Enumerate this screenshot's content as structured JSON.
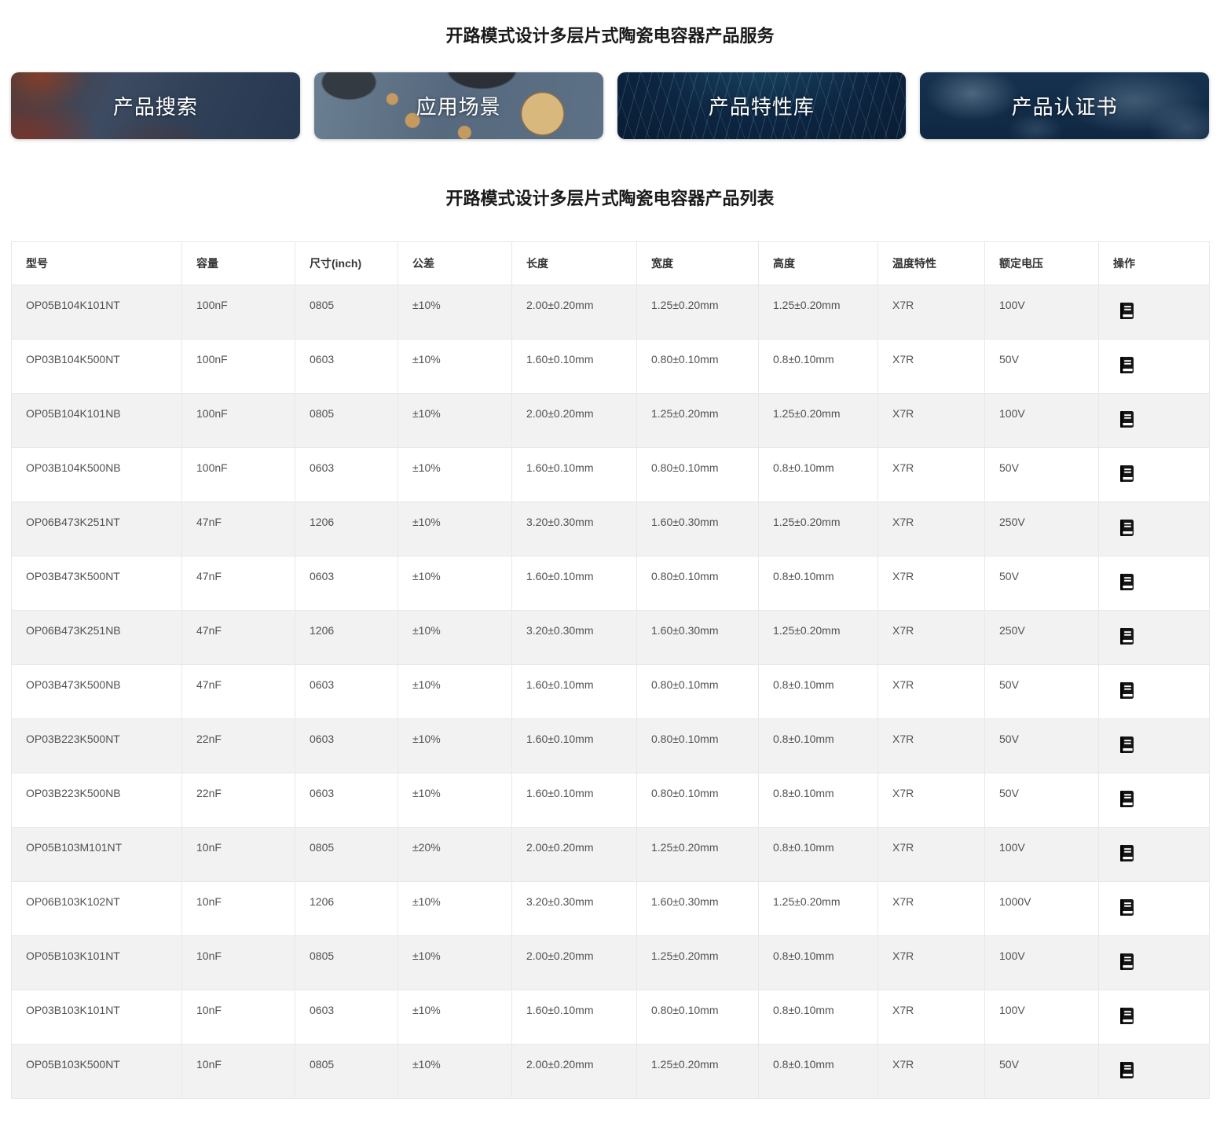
{
  "page": {
    "service_title": "开路模式设计多层片式陶瓷电容器产品服务",
    "list_title": "开路模式设计多层片式陶瓷电容器产品列表"
  },
  "nav_cards": [
    {
      "label": "产品搜索"
    },
    {
      "label": "应用场景"
    },
    {
      "label": "产品特性库"
    },
    {
      "label": "产品认证书"
    }
  ],
  "table": {
    "columns": [
      "型号",
      "容量",
      "尺寸(inch)",
      "公差",
      "长度",
      "宽度",
      "高度",
      "温度特性",
      "额定电压",
      "操作"
    ],
    "column_keys": [
      "model",
      "capacity",
      "size",
      "tolerance",
      "length",
      "width",
      "height",
      "temp-char",
      "rated-voltage",
      "action"
    ],
    "action_icon": "book-icon",
    "rows": [
      [
        "OP05B104K101NT",
        "100nF",
        "0805",
        "±10%",
        "2.00±0.20mm",
        "1.25±0.20mm",
        "1.25±0.20mm",
        "X7R",
        "100V"
      ],
      [
        "OP03B104K500NT",
        "100nF",
        "0603",
        "±10%",
        "1.60±0.10mm",
        "0.80±0.10mm",
        "0.8±0.10mm",
        "X7R",
        "50V"
      ],
      [
        "OP05B104K101NB",
        "100nF",
        "0805",
        "±10%",
        "2.00±0.20mm",
        "1.25±0.20mm",
        "1.25±0.20mm",
        "X7R",
        "100V"
      ],
      [
        "OP03B104K500NB",
        "100nF",
        "0603",
        "±10%",
        "1.60±0.10mm",
        "0.80±0.10mm",
        "0.8±0.10mm",
        "X7R",
        "50V"
      ],
      [
        "OP06B473K251NT",
        "47nF",
        "1206",
        "±10%",
        "3.20±0.30mm",
        "1.60±0.30mm",
        "1.25±0.20mm",
        "X7R",
        "250V"
      ],
      [
        "OP03B473K500NT",
        "47nF",
        "0603",
        "±10%",
        "1.60±0.10mm",
        "0.80±0.10mm",
        "0.8±0.10mm",
        "X7R",
        "50V"
      ],
      [
        "OP06B473K251NB",
        "47nF",
        "1206",
        "±10%",
        "3.20±0.30mm",
        "1.60±0.30mm",
        "1.25±0.20mm",
        "X7R",
        "250V"
      ],
      [
        "OP03B473K500NB",
        "47nF",
        "0603",
        "±10%",
        "1.60±0.10mm",
        "0.80±0.10mm",
        "0.8±0.10mm",
        "X7R",
        "50V"
      ],
      [
        "OP03B223K500NT",
        "22nF",
        "0603",
        "±10%",
        "1.60±0.10mm",
        "0.80±0.10mm",
        "0.8±0.10mm",
        "X7R",
        "50V"
      ],
      [
        "OP03B223K500NB",
        "22nF",
        "0603",
        "±10%",
        "1.60±0.10mm",
        "0.80±0.10mm",
        "0.8±0.10mm",
        "X7R",
        "50V"
      ],
      [
        "OP05B103M101NT",
        "10nF",
        "0805",
        "±20%",
        "2.00±0.20mm",
        "1.25±0.20mm",
        "0.8±0.10mm",
        "X7R",
        "100V"
      ],
      [
        "OP06B103K102NT",
        "10nF",
        "1206",
        "±10%",
        "3.20±0.30mm",
        "1.60±0.30mm",
        "1.25±0.20mm",
        "X7R",
        "1000V"
      ],
      [
        "OP05B103K101NT",
        "10nF",
        "0805",
        "±10%",
        "2.00±0.20mm",
        "1.25±0.20mm",
        "0.8±0.10mm",
        "X7R",
        "100V"
      ],
      [
        "OP03B103K101NT",
        "10nF",
        "0603",
        "±10%",
        "1.60±0.10mm",
        "0.80±0.10mm",
        "0.8±0.10mm",
        "X7R",
        "100V"
      ],
      [
        "OP05B103K500NT",
        "10nF",
        "0805",
        "±10%",
        "2.00±0.20mm",
        "1.25±0.20mm",
        "0.8±0.10mm",
        "X7R",
        "50V"
      ]
    ]
  },
  "colors": {
    "row_stripe": "#f2f2f2",
    "table_border": "#e8e8e8",
    "card_text": "#ffffff",
    "body_text": "#515151",
    "title_text": "#1a1a1a",
    "card_navy": "#0d2440"
  }
}
